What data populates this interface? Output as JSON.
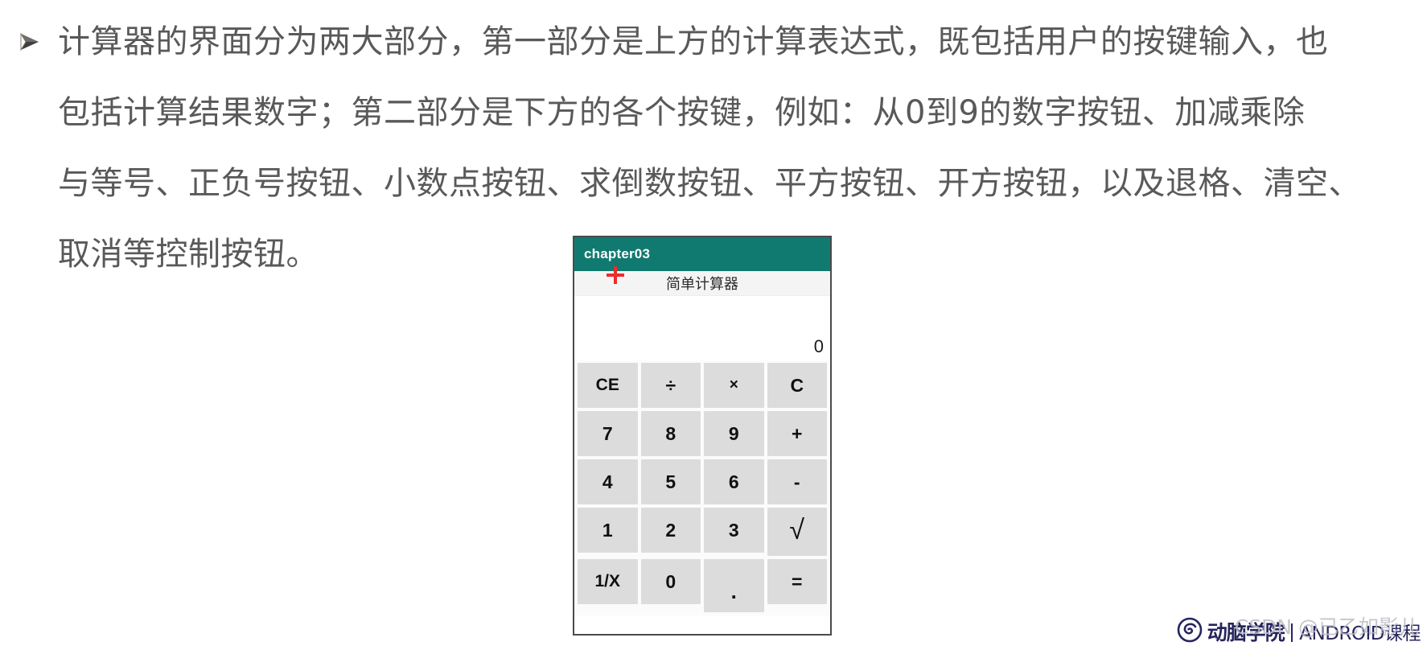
{
  "slide": {
    "bullet_icon": "arrowhead-bullet-icon",
    "lines": [
      {
        "text": "计算器的界面分为两大部分，第一部分是上方的计算表达式，既包括用户的按键输入，也",
        "bulleted": true
      },
      {
        "text": "包括计算结果数字；第二部分是下方的各个按键，例如：从0到9的数字按钮、加减乘除",
        "bulleted": false
      },
      {
        "text": "与等号、正负号按钮、小数点按钮、求倒数按钮、平方按钮、开方按钮，以及退格、清空、",
        "bulleted": false
      },
      {
        "text": "取消等控制按钮。",
        "bulleted": false
      }
    ]
  },
  "calculator": {
    "app_bar": {
      "title": "chapter03",
      "background_color": "#107a70",
      "text_color": "#ffffff"
    },
    "subtitle": "简单计算器",
    "cursor": {
      "icon": "crosshair-cursor-icon",
      "color": "#ef2b2b"
    },
    "display": {
      "expression": "",
      "result": "0"
    },
    "keypad": {
      "key_color": "#dcdcdc",
      "rows": [
        [
          {
            "label": "CE",
            "name": "key-clear-entry"
          },
          {
            "label": "÷",
            "name": "key-divide"
          },
          {
            "label": "×",
            "name": "key-multiply"
          },
          {
            "label": "C",
            "name": "key-clear"
          }
        ],
        [
          {
            "label": "7",
            "name": "key-7"
          },
          {
            "label": "8",
            "name": "key-8"
          },
          {
            "label": "9",
            "name": "key-9"
          },
          {
            "label": "+",
            "name": "key-plus"
          }
        ],
        [
          {
            "label": "4",
            "name": "key-4"
          },
          {
            "label": "5",
            "name": "key-5"
          },
          {
            "label": "6",
            "name": "key-6"
          },
          {
            "label": "-",
            "name": "key-minus"
          }
        ],
        [
          {
            "label": "1",
            "name": "key-1"
          },
          {
            "label": "2",
            "name": "key-2"
          },
          {
            "label": "3",
            "name": "key-3"
          },
          {
            "label": "√",
            "name": "key-sqrt"
          }
        ],
        [
          {
            "label": "1/X",
            "name": "key-reciprocal"
          },
          {
            "label": "0",
            "name": "key-0"
          },
          {
            "label": ".",
            "name": "key-decimal-point"
          },
          {
            "label": "=",
            "name": "key-equals"
          }
        ]
      ]
    }
  },
  "footer": {
    "logo_icon": "spiral-brain-logo-icon",
    "brand": "动脑学院",
    "divider": "|",
    "course": "ANDROID课程",
    "watermark": "CSDN @已乙如影儿",
    "brand_color": "#26255c"
  }
}
